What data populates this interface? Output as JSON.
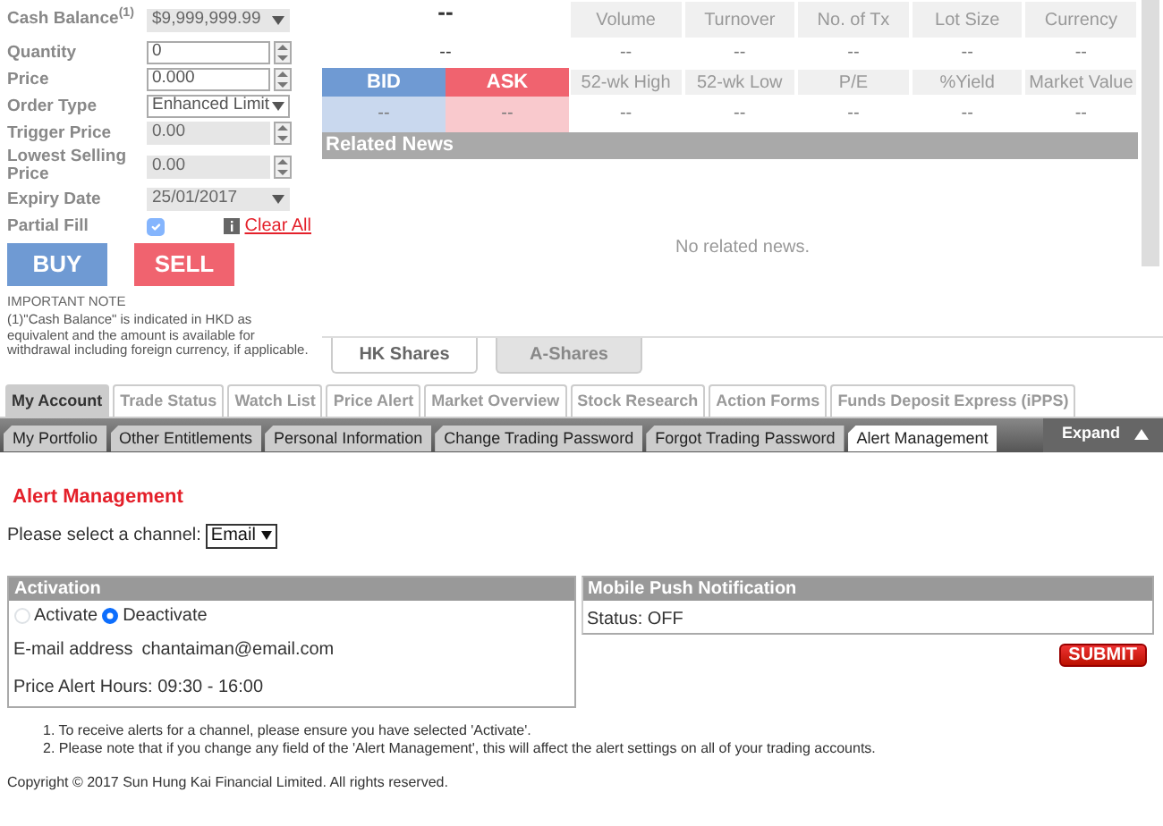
{
  "order_form": {
    "fields": [
      {
        "label": "Cash Balance$^{(1)}$",
        "kind": "select",
        "value": "$9,999,999.99",
        "disabled": true
      },
      {
        "label": "Quantity",
        "kind": "spinner",
        "value": "0",
        "disabled": false
      },
      {
        "label": "Price",
        "kind": "spinner",
        "value": "0.000",
        "disabled": false
      },
      {
        "label": "Order Type",
        "kind": "select",
        "value": "Enhanced Limit",
        "disabled": false
      },
      {
        "label": "Trigger Price",
        "kind": "spinner",
        "value": "0.00",
        "disabled": true
      },
      {
        "label": "Lowest Selling Price",
        "kind": "spinner",
        "value": "0.00",
        "disabled": true
      },
      {
        "label": "Expiry Date",
        "kind": "select",
        "value": "25/01/2017",
        "disabled": true
      },
      {
        "label": "Partial Fill",
        "kind": "checkbox",
        "checked": true,
        "disabled": true
      }
    ],
    "clear_all": "Clear All",
    "buy": "BUY",
    "sell": "SELL",
    "note_title": "IMPORTANT NOTE",
    "note": "(1)\"Cash Balance\" is indicated in HKD as equivalent and the amount is available for withdrawal including foreign currency, if applicable."
  },
  "quote": {
    "price": "--",
    "change": "--",
    "bid": {
      "label": "BID",
      "value": "--"
    },
    "ask": {
      "label": "ASK",
      "value": "--"
    },
    "stats": [
      {
        "label": "Volume",
        "value": "--"
      },
      {
        "label": "Turnover",
        "value": "--"
      },
      {
        "label": "No. of Tx",
        "value": "--"
      },
      {
        "label": "Lot Size",
        "value": "--"
      },
      {
        "label": "Currency",
        "value": "--"
      },
      {
        "label": "52-wk High",
        "value": "--"
      },
      {
        "label": "52-wk Low",
        "value": "--"
      },
      {
        "label": "P/E",
        "value": "--"
      },
      {
        "label": "%Yield",
        "value": "--"
      },
      {
        "label": "Market Value",
        "value": "--"
      }
    ],
    "news_title": "Related News",
    "news_empty": "No related news."
  },
  "market_tabs": [
    {
      "label": "HK Shares",
      "selected": true
    },
    {
      "label": "A-Shares",
      "selected": false
    }
  ],
  "main_tabs": [
    {
      "label": "My Account",
      "selected": true
    },
    {
      "label": "Trade Status",
      "selected": false
    },
    {
      "label": "Watch List",
      "selected": false
    },
    {
      "label": "Price Alert",
      "selected": false
    },
    {
      "label": "Market Overview",
      "selected": false
    },
    {
      "label": "Stock Research",
      "selected": false
    },
    {
      "label": "Action Forms",
      "selected": false
    },
    {
      "label": "Funds Deposit Express (iPPS)",
      "selected": false
    }
  ],
  "sub_tabs": [
    {
      "label": "My Portfolio",
      "selected": false
    },
    {
      "label": "Other Entitlements",
      "selected": false
    },
    {
      "label": "Personal Information",
      "selected": false
    },
    {
      "label": "Change Trading Password",
      "selected": false
    },
    {
      "label": "Forgot Trading Password",
      "selected": false
    },
    {
      "label": "Alert Management",
      "selected": true
    }
  ],
  "expand": "Expand",
  "alert": {
    "title": "Alert Management",
    "channel_label": "Please select a channel:",
    "channel": "Email",
    "activation": {
      "title": "Activation",
      "options": [
        {
          "label": "Activate",
          "selected": false
        },
        {
          "label": "Deactivate",
          "selected": true
        }
      ],
      "email_label": "E-mail address",
      "email": "chantaiman@email.com",
      "hours": "Price Alert Hours: 09:30 - 16:00"
    },
    "mobile": {
      "title": "Mobile Push Notification",
      "status": "Status: OFF"
    },
    "submit": "SUBMIT",
    "notes": [
      "1. To receive alerts for a channel, please ensure you have selected 'Activate'.",
      "2. Please note that if you change any field of the 'Alert Management', this will affect the alert settings on all of your trading accounts."
    ],
    "copyright": "Copyright © 2017 Sun Hung Kai Financial Limited. All rights reserved."
  }
}
